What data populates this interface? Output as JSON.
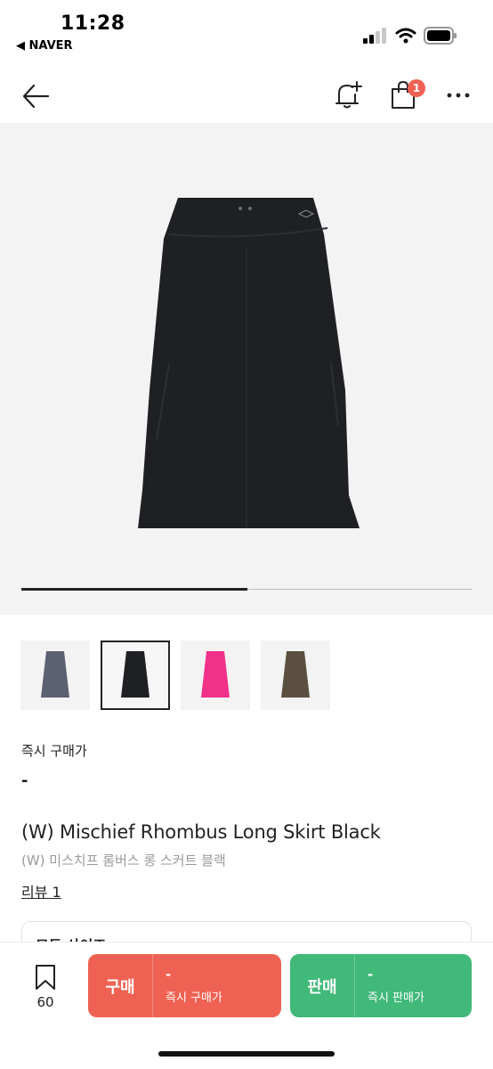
{
  "status_bar": {
    "time": "11:28",
    "back_app": "◀ NAVER"
  },
  "header": {
    "cart_count": "1"
  },
  "gallery": {
    "progress": 0.5,
    "thumbnail_colors": [
      "#5b6170",
      "#1f2024",
      "#f2318a",
      "#5b5040"
    ],
    "selected_index": 1
  },
  "product": {
    "instant_label": "즉시 구매가",
    "price": "-",
    "title_en": "(W) Mischief Rhombus Long Skirt Black",
    "title_ko": "(W) 미스치프 롬버스 롱 스커트 블랙",
    "review": "리뷰 1",
    "size_label": "모든 사이즈"
  },
  "bottom": {
    "bookmark_count": "60",
    "buy": {
      "label": "구매",
      "price": "-",
      "sub": "즉시 구매가",
      "color": "#ef6253"
    },
    "sell": {
      "label": "판매",
      "price": "-",
      "sub": "즉시 판매가",
      "color": "#41b979"
    }
  }
}
